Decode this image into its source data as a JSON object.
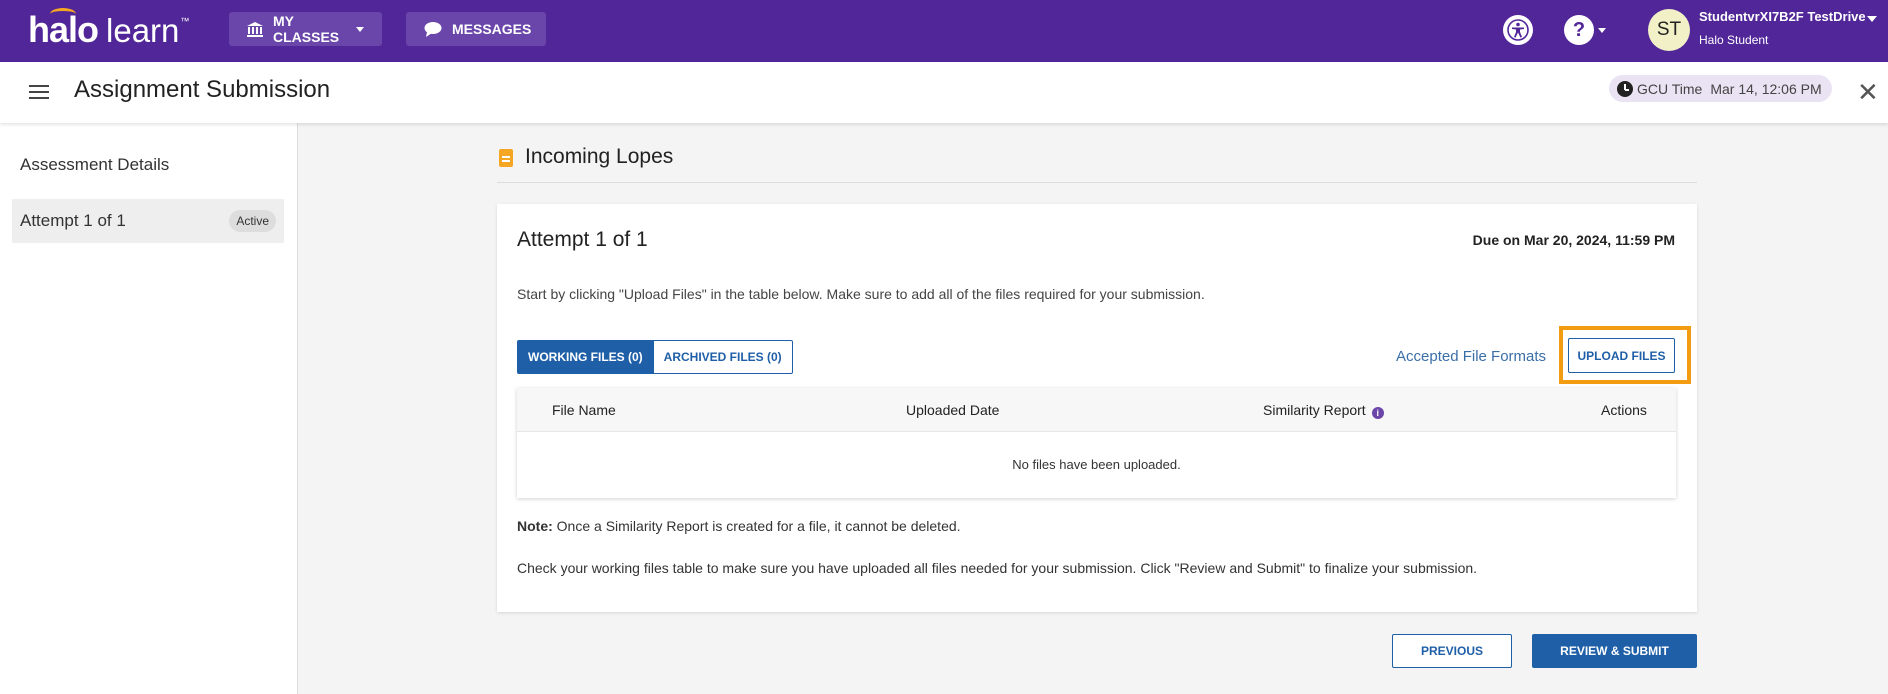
{
  "header": {
    "logo_main": "halo",
    "logo_sub": "learn",
    "logo_tm": "™",
    "my_classes_label": "MY CLASSES",
    "messages_label": "MESSAGES",
    "help_glyph": "?",
    "user": {
      "initials": "ST",
      "name": "StudentvrXI7B2F TestDrive",
      "role": "Halo Student"
    },
    "icons": [
      "institution-icon",
      "chat-bubble-icon",
      "accessibility-icon",
      "help-icon",
      "chevron-down-icon"
    ]
  },
  "titlebar": {
    "title": "Assignment Submission",
    "gcu_label": "GCU Time",
    "gcu_time": "Mar 14, 12:06 PM",
    "close_glyph": "✕"
  },
  "sidebar": {
    "heading": "Assessment Details",
    "items": [
      {
        "label": "Attempt 1 of 1",
        "badge": "Active"
      }
    ]
  },
  "main": {
    "section_title": "Incoming Lopes",
    "attempt_title": "Attempt 1 of 1",
    "due": "Due on Mar 20, 2024, 11:59 PM",
    "instructions": "Start by clicking \"Upload Files\" in the table below. Make sure to add all of the files required for your submission.",
    "tabs": [
      {
        "label": "WORKING FILES (0)",
        "active": true
      },
      {
        "label": "ARCHIVED FILES (0)",
        "active": false
      }
    ],
    "accepted_formats_link": "Accepted File Formats",
    "upload_button": "UPLOAD FILES",
    "table": {
      "columns": [
        "File Name",
        "Uploaded Date",
        "Similarity Report",
        "Actions"
      ],
      "info_glyph": "i",
      "empty_message": "No files have been uploaded."
    },
    "note_label": "Note:",
    "note_text": " Once a Similarity Report is created for a file, it cannot be deleted.",
    "check_text": "Check your working files table to make sure you have uploaded all files needed for your submission. Click \"Review and Submit\" to finalize your submission.",
    "previous_button": "PREVIOUS",
    "submit_button": "REVIEW & SUBMIT"
  },
  "colors": {
    "brand_purple": "#512698",
    "primary_blue": "#1f5fa8",
    "highlight_orange": "#f39c12",
    "doc_icon_orange": "#f5a623"
  }
}
